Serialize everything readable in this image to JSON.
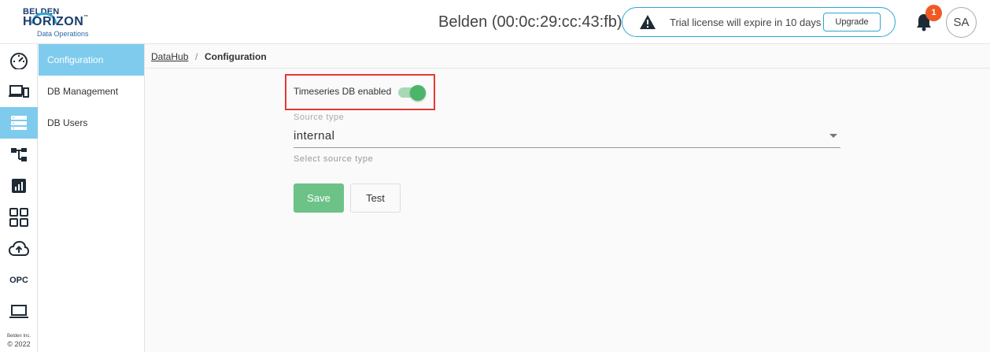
{
  "header": {
    "logo": {
      "line1": "BELDEN",
      "line2": "HORIZON",
      "tm": "™",
      "line3": "Data Operations"
    },
    "device_title": "Belden (00:0c:29:cc:43:fb)",
    "license_message": "Trial license will expire in 10 days",
    "upgrade_label": "Upgrade",
    "notification_count": "1",
    "user_initials": "SA"
  },
  "rail": {
    "icons": [
      "dashboard-icon",
      "devices-icon",
      "database-icon",
      "hierarchy-icon",
      "chart-icon",
      "apps-grid-icon",
      "cloud-upload-icon",
      "opc-icon",
      "laptop-icon"
    ],
    "opc_label": "OPC",
    "company": "Belden Inc.",
    "year": "© 2022"
  },
  "subnav": {
    "items": [
      {
        "label": "Configuration",
        "active": true
      },
      {
        "label": "DB Management",
        "active": false
      },
      {
        "label": "DB Users",
        "active": false
      }
    ]
  },
  "breadcrumb": {
    "root": "DataHub",
    "separator": "/",
    "current": "Configuration"
  },
  "form": {
    "timeseries_label": "Timeseries DB enabled",
    "timeseries_enabled": true,
    "source_type_label": "Source type",
    "source_type_value": "internal",
    "source_type_helper": "Select source type",
    "save_label": "Save",
    "test_label": "Test"
  },
  "colors": {
    "accent": "#7ecbed",
    "highlight_border": "#e53935",
    "save_button": "#6dc287",
    "toggle_on": "#4bb56a",
    "badge": "#f05a22",
    "brand_blue": "#2fa7d6"
  }
}
